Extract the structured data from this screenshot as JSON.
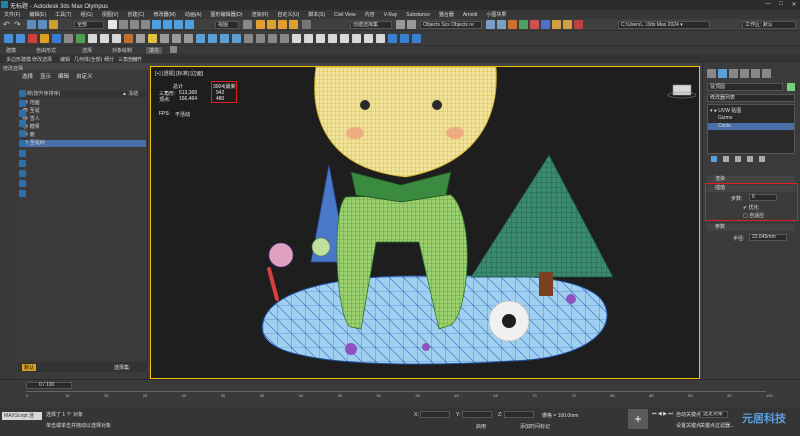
{
  "window": {
    "title": "无标题 - Autodesk 3ds Max Olympus",
    "controls": [
      "—",
      "□",
      "✕"
    ]
  },
  "menu": [
    "文件(F)",
    "编辑(E)",
    "工具(T)",
    "组(G)",
    "视图(V)",
    "创建(C)",
    "修改器(M)",
    "动画(A)",
    "图形编辑器(D)",
    "渲染(R)",
    "自定义(U)",
    "脚本(S)",
    "Civil View",
    "内容",
    "V-Ray",
    "Substance",
    "猫台器",
    "Arnold",
    "小图块果"
  ],
  "toolbar": {
    "filter_dropdown": "全部",
    "view_dropdown": "视图",
    "selection_set_placeholder": "创建选择集",
    "objects_toolbox": "Objects Scs Objects re",
    "workspace_path": "C:\\Users\\...\\3ds Max 2024 ▾",
    "workspace_dropdown": "工作区: 默认"
  },
  "ribbon": {
    "tabs": [
      "建模",
      "自由形式",
      "选择",
      "对象绘制",
      "填充"
    ],
    "sub": [
      "多边形建模",
      "修改选择",
      "编辑",
      "几何体(全部)",
      "细分",
      "三角剖分",
      "对齐",
      "可见性",
      "属性"
    ],
    "sub2": [
      "修改选择",
      "选择",
      "编辑",
      "多边形建模",
      "修改器",
      "编辑修改器"
    ]
  },
  "scene_explorer": {
    "tabs": [
      "选择",
      "显示",
      "编辑",
      "自定义"
    ],
    "header": "名称(按升序排序)",
    "header_col": "▲ 冻结",
    "items": [
      "地面",
      "圣诞",
      "雪人",
      "糖果",
      "鹿",
      "圣诞树"
    ],
    "footer_layer": "默认",
    "footer_set": "选择集:"
  },
  "viewport": {
    "label": "[+] [透视] [标准] [边面]",
    "stats": {
      "total_label": "总计",
      "selected_label": "3004(最新)",
      "tris_label": "三角形:",
      "tris": "513,368",
      "verts_label": "顶点:",
      "verts": "166,464",
      "sel_tris": "942",
      "sel_verts": "480",
      "fps_label": "FPS:",
      "fps": "不活动"
    }
  },
  "command_panel": {
    "object_name": "鼠顶圆",
    "modifier_list": "修改器列表",
    "stack": [
      "▾ ● UVW 贴图",
      "Gizmo",
      "Circle"
    ],
    "rollouts": {
      "render": "渲染",
      "interp": "插值",
      "steps_label": "步数:",
      "steps": "6",
      "optimize": "优化",
      "adaptive": "自适应",
      "params": "参数",
      "radius_label": "半径:",
      "radius": "22.645mm"
    }
  },
  "timeline": {
    "frame": "0 / 100",
    "ticks": [
      "0",
      "10",
      "15",
      "20",
      "25",
      "30",
      "35",
      "40",
      "45",
      "50",
      "55",
      "60",
      "65",
      "70",
      "75",
      "80",
      "85",
      "90",
      "95",
      "100"
    ]
  },
  "status": {
    "selected": "选择了 1 个 对象",
    "hint": "单击或单击并拖动以选择对象",
    "script_label": "MAXScript 迷",
    "x_label": "X:",
    "y_label": "Y:",
    "z_label": "Z:",
    "grid": "栅格 = 100.0mm",
    "add_time": "添加时间标记",
    "autokey": "自动关键点",
    "selected_obj": "选定对象",
    "setkey": "设置关键点",
    "key_filter": "关键点过滤器...",
    "enable": "启用",
    "watermark": "元居科技"
  },
  "colors": {
    "highlight_red": "#e02020",
    "viewport_border": "#f0c000",
    "wire_yellow": "#e8c840",
    "wire_green": "#3aa040",
    "wire_blue": "#3060c0"
  }
}
